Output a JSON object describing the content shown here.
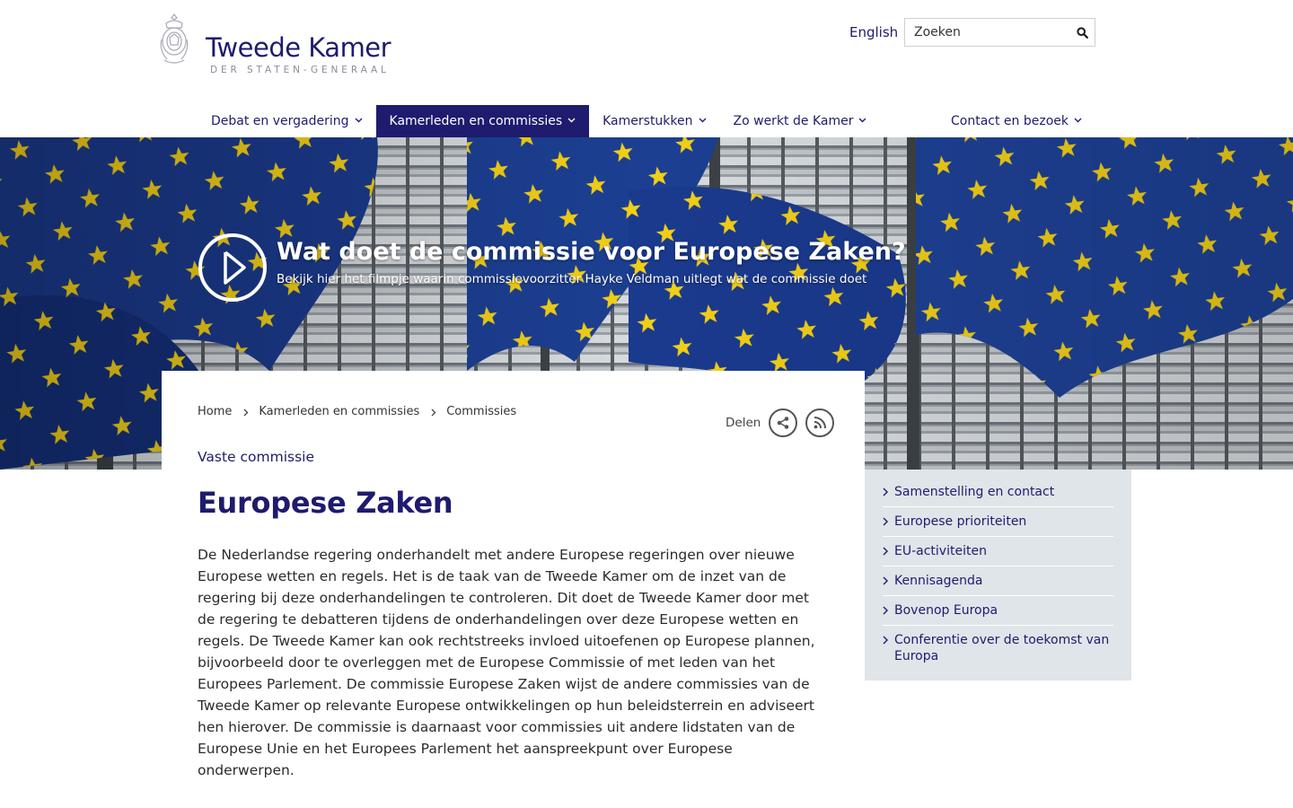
{
  "header": {
    "logo_name": "Tweede Kamer",
    "logo_sub": "DER STATEN-GENERAAL",
    "language_link": "English",
    "search_placeholder": "Zoeken"
  },
  "nav": {
    "items": [
      {
        "label": "Debat en vergadering",
        "active": false
      },
      {
        "label": "Kamerleden en commissies",
        "active": true
      },
      {
        "label": "Kamerstukken",
        "active": false
      },
      {
        "label": "Zo werkt de Kamer",
        "active": false
      }
    ],
    "right_item": {
      "label": "Contact en bezoek"
    }
  },
  "hero": {
    "title": "Wat doet de commissie voor Europese Zaken?",
    "subtitle": "Bekijk hier het filmpje waarin commissievoorzitter Hayke Veldman uitlegt wat de commissie doet"
  },
  "breadcrumb": [
    "Home",
    "Kamerleden en commissies",
    "Commissies"
  ],
  "share": {
    "label": "Delen"
  },
  "page": {
    "kicker": "Vaste commissie",
    "title": "Europese Zaken",
    "intro": "De Nederlandse regering onderhandelt met andere Europese regeringen over nieuwe Europese wetten en regels. Het is de taak van de Tweede Kamer om de inzet van de regering bij deze onderhandelingen te controleren. Dit doet de Tweede Kamer door met de regering te debatteren tijdens de onderhandelingen over deze Europese wetten en regels. De Tweede Kamer kan ook rechtstreeks invloed uitoefenen op Europese plannen, bijvoorbeeld door te overleggen met de Europese Commissie of met leden van het Europees Parlement. De commissie Europese Zaken wijst de andere commissies van de Tweede Kamer op relevante Europese ontwikkelingen op hun beleidsterrein en adviseert hen hierover. De commissie is daarnaast voor commissies uit andere lidstaten van de Europese Unie en het Europees Parlement het aanspreekpunt over Europese onderwerpen."
  },
  "sidebar": {
    "items": [
      {
        "label": "Samenstelling en contact"
      },
      {
        "label": "Europese prioriteiten"
      },
      {
        "label": "EU-activiteiten"
      },
      {
        "label": "Kennisagenda"
      },
      {
        "label": "Bovenop Europa"
      },
      {
        "label": "Conferentie over de toekomst van Europa"
      }
    ]
  },
  "colors": {
    "brand_navy": "#1f1b6e",
    "sidebar_bg": "#dfe5e9",
    "eu_blue": "#1d3d8f",
    "eu_star": "#f5d313"
  },
  "icons": {
    "search": "search-icon",
    "play": "play-icon",
    "share": "share-icon",
    "rss": "rss-icon",
    "chevron": "chevron-down-icon",
    "chevron_right": "chevron-right-icon"
  }
}
